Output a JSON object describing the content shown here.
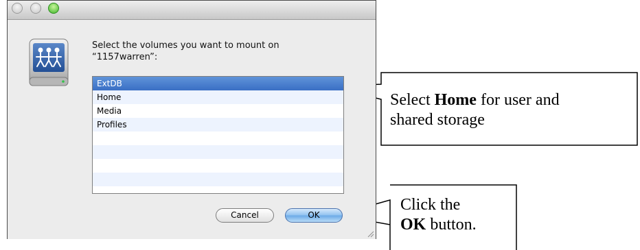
{
  "dialog": {
    "prompt_line1": "Select the volumes you want to mount on",
    "prompt_line2": "“1157warren”:",
    "volumes": [
      {
        "label": "ExtDB",
        "selected": true
      },
      {
        "label": "Home",
        "selected": false
      },
      {
        "label": "Media",
        "selected": false
      },
      {
        "label": "Profiles",
        "selected": false
      }
    ],
    "cancel_label": "Cancel",
    "ok_label": "OK",
    "drive_icon": "network-drive-icon"
  },
  "callouts": {
    "home": {
      "prefix": "Select ",
      "bold": "Home",
      "suffix_line1": " for user and",
      "line2": "shared storage"
    },
    "ok": {
      "line1": "Click the",
      "bold": "OK",
      "suffix": " button."
    }
  },
  "colors": {
    "selection": "#3a6fc4",
    "alt_row": "#edf3fe",
    "zoom_button": "#3fb52b"
  }
}
